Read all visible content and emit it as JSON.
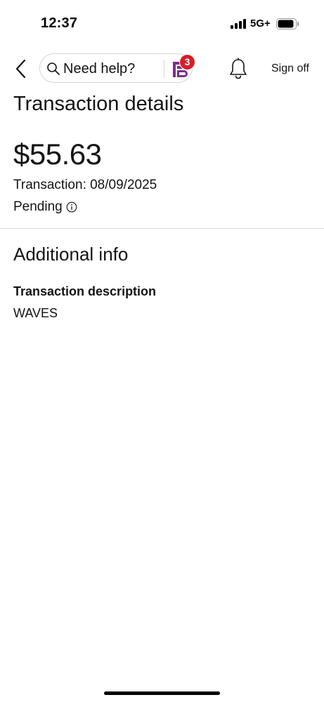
{
  "status_bar": {
    "time": "12:37",
    "network": "5G+"
  },
  "header": {
    "help_label": "Need help?",
    "help_badge_count": "3",
    "sign_off_label": "Sign off"
  },
  "transaction": {
    "page_title": "Transaction details",
    "amount": "$55.63",
    "date_line": "Transaction: 08/09/2025",
    "status": "Pending"
  },
  "additional_info": {
    "section_title": "Additional info",
    "description_label": "Transaction description",
    "description_value": "WAVES"
  },
  "icons": {
    "back": "chevron-left-icon",
    "search": "search-icon",
    "assistant": "assistant-logo-icon",
    "notifications": "bell-icon",
    "info": "info-icon"
  },
  "colors": {
    "badge": "#d71e28",
    "assistant_logo": "#7b2d8e",
    "text": "#141414"
  }
}
